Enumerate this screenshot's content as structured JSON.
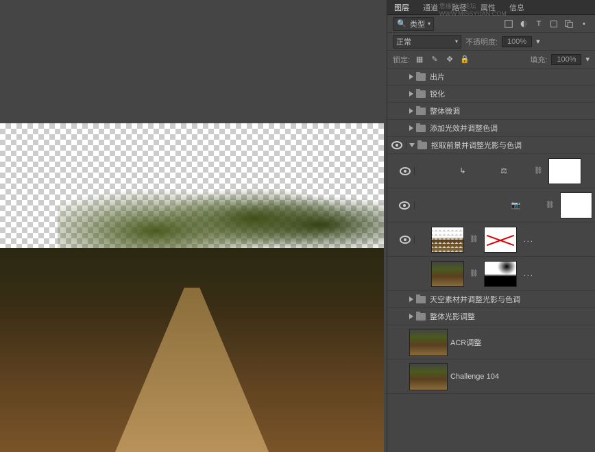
{
  "watermark": "思缘设计论坛  WWW.MISSYUAN.COM",
  "tabs": {
    "layers": "图层",
    "channels": "通道",
    "paths": "路径",
    "props": "属性",
    "info": "信息"
  },
  "filter": {
    "label": "类型"
  },
  "blend": {
    "mode": "正常",
    "opacity_label": "不透明度:",
    "opacity": "100%"
  },
  "lock": {
    "label": "锁定:",
    "fill_label": "填充:",
    "fill": "100%"
  },
  "groups": {
    "export": "出片",
    "sharpen": "锐化",
    "global_adjust": "整体微调",
    "add_light": "添加光效并调整色调",
    "fg_extract": "抠取前景并调整光影与色调",
    "sky_mat": "天空素材并调整光影与色调",
    "global_light": "整体光影调整"
  },
  "layers": {
    "acr": "ACR调整",
    "challenge": "Challenge 104"
  }
}
